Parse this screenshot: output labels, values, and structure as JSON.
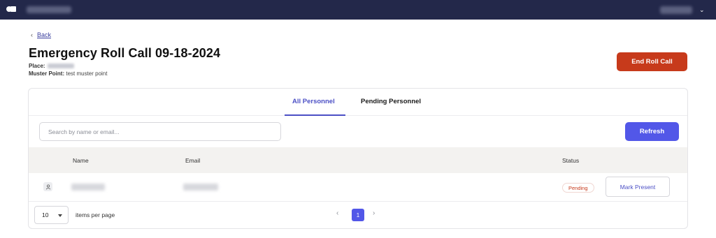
{
  "topbar": {
    "logo_icon": "brand-logo-icon",
    "org_name_blurred": true,
    "user_name_blurred": true,
    "user_menu_icon": "chevron-down-icon"
  },
  "back": {
    "chevron": "‹",
    "label": "Back"
  },
  "page": {
    "title": "Emergency Roll Call 09-18-2024",
    "place_label": "Place:",
    "place_value_blurred": true,
    "muster_label": "Muster Point:",
    "muster_value": "test muster point"
  },
  "end_button": {
    "label": "End Roll Call",
    "color": "#c73a1b"
  },
  "tabs": [
    {
      "label": "All Personnel",
      "active": true
    },
    {
      "label": "Pending Personnel",
      "active": false
    }
  ],
  "search": {
    "placeholder": "Search by name or email...",
    "value": ""
  },
  "refresh_button": {
    "label": "Refresh",
    "color": "#5257e8"
  },
  "table": {
    "columns": [
      "Name",
      "Email",
      "Status"
    ],
    "rows": [
      {
        "avatar_icon": "person-icon",
        "name_blurred": true,
        "email_blurred": true,
        "status": "Pending",
        "action": "Mark Present"
      }
    ]
  },
  "pagination": {
    "per_page": "10",
    "per_page_label": "items per page",
    "prev": "‹",
    "current_page": "1",
    "next": "›"
  },
  "colors": {
    "accent": "#4b4fc5",
    "topbar": "#23284a",
    "danger": "#c73a1b"
  }
}
